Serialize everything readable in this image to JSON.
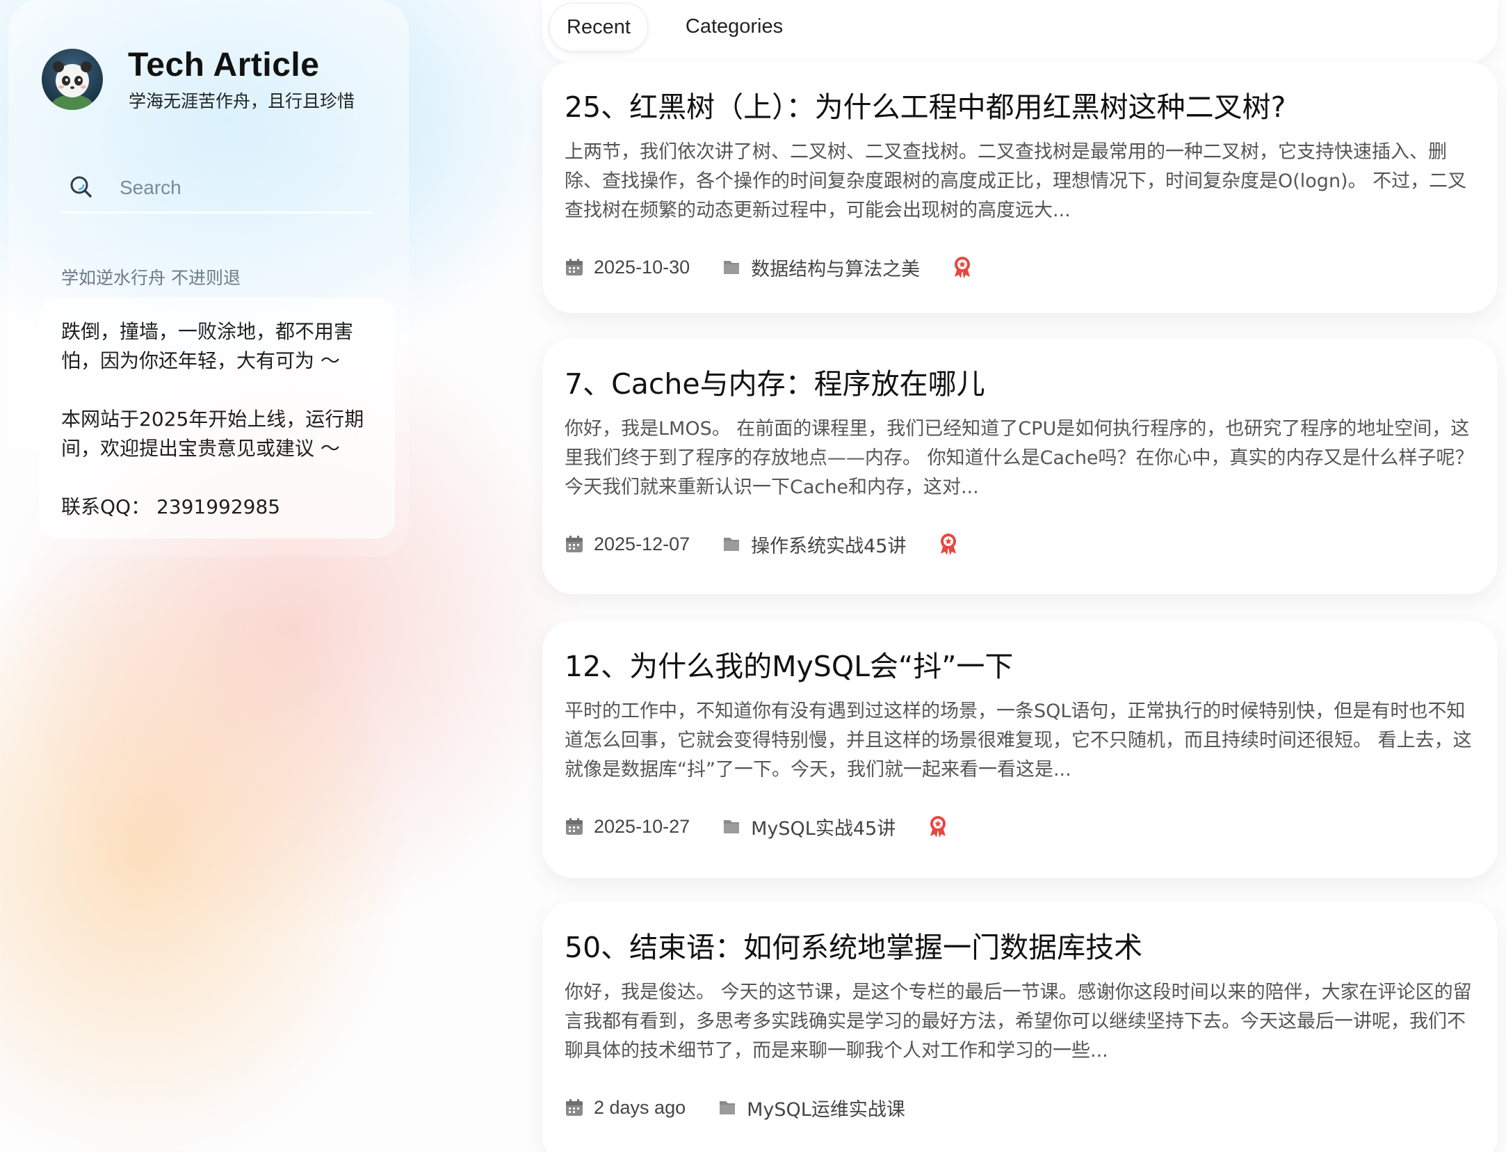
{
  "sidebar": {
    "avatar_icon": "panda-avatar-icon",
    "title": "Tech Article",
    "subtitle": "学海无涯苦作舟，且行且珍惜",
    "search": {
      "placeholder": "Search",
      "value": "",
      "icon": "search-icon"
    },
    "section_label": "学如逆水行舟 不进则退",
    "info_lines": [
      "跌倒，撞墙，一败涂地，都不用害怕，因为你还年轻，大有可为 ～",
      "本网站于2025年开始上线，运行期间，欢迎提出宝贵意见或建议 ～",
      "联系QQ： 2391992985"
    ]
  },
  "tabs": [
    {
      "label": "Recent",
      "active": true
    },
    {
      "label": "Categories",
      "active": false
    }
  ],
  "articles": [
    {
      "title": "25、红黑树（上）：为什么工程中都用红黑树这种二叉树?",
      "excerpt": "上两节，我们依次讲了树、二叉树、二叉查找树。二叉查找树是最常用的一种二叉树，它支持快速插入、删除、查找操作，各个操作的时间复杂度跟树的高度成正比，理想情况下，时间复杂度是O(logn)。 不过，二叉查找树在频繁的动态更新过程中，可能会出现树的高度远大...",
      "date": "2025-10-30",
      "category": "数据结构与算法之美",
      "featured": true
    },
    {
      "title": "7、Cache与内存：程序放在哪儿",
      "excerpt": "你好，我是LMOS。 在前面的课程里，我们已经知道了CPU是如何执行程序的，也研究了程序的地址空间，这里我们终于到了程序的存放地点——内存。 你知道什么是Cache吗？在你心中，真实的内存又是什么样子呢？今天我们就来重新认识一下Cache和内存，这对...",
      "date": "2025-12-07",
      "category": "操作系统实战45讲",
      "featured": true
    },
    {
      "title": "12、为什么我的MySQL会“抖”一下",
      "excerpt": "平时的工作中，不知道你有没有遇到过这样的场景，一条SQL语句，正常执行的时候特别快，但是有时也不知道怎么回事，它就会变得特别慢，并且这样的场景很难复现，它不只随机，而且持续时间还很短。 看上去，这就像是数据库“抖”了一下。今天，我们就一起来看一看这是...",
      "date": "2025-10-27",
      "category": "MySQL实战45讲",
      "featured": true
    },
    {
      "title": "50、结束语：如何系统地掌握一门数据库技术",
      "excerpt": "你好，我是俊达。 今天的这节课，是这个专栏的最后一节课。感谢你这段时间以来的陪伴，大家在评论区的留言我都有看到，多思考多实践确实是学习的最好方法，希望你可以继续坚持下去。今天这最后一讲呢，我们不聊具体的技术细节了，而是来聊一聊我个人对工作和学习的一些...",
      "date": "2 days ago",
      "category": "MySQL运维实战课",
      "featured": false
    }
  ],
  "meta_icons": {
    "date": "calendar-icon",
    "category": "folder-icon",
    "featured": "award-ribbon-icon"
  },
  "colors": {
    "award": "#e8473f",
    "meta_icon": "#8a8a8a",
    "title": "#111111",
    "excerpt": "#555555"
  }
}
